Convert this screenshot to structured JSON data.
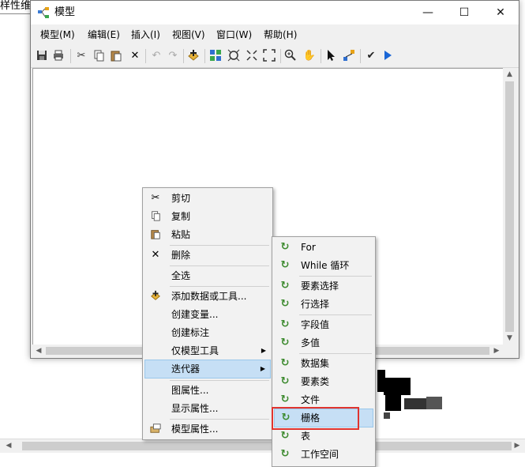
{
  "background": {
    "title_fragment": "样性维"
  },
  "window": {
    "title": "模型",
    "buttons": {
      "minimize": "—",
      "maximize": "☐",
      "close": "✕"
    }
  },
  "menubar": [
    "模型(M)",
    "编辑(E)",
    "插入(I)",
    "视图(V)",
    "窗口(W)",
    "帮助(H)"
  ],
  "toolbar_icons": [
    "save-icon",
    "print-icon",
    "cut-icon",
    "copy-icon",
    "paste-icon",
    "delete-icon",
    "undo-icon",
    "redo-icon",
    "add-data-icon",
    "auto-layout-icon",
    "full-extent-icon",
    "fixed-zoom-in-icon",
    "fixed-zoom-out-icon",
    "zoom-in-icon",
    "pan-icon",
    "select-icon",
    "connect-icon",
    "validate-icon",
    "run-icon"
  ],
  "context_menu": {
    "items": [
      {
        "label": "剪切",
        "icon": "cut-icon"
      },
      {
        "label": "复制",
        "icon": "copy-icon"
      },
      {
        "label": "粘贴",
        "icon": "paste-icon"
      },
      {
        "label": "删除",
        "icon": "delete-icon"
      },
      {
        "label": "全选",
        "icon": ""
      },
      {
        "label": "添加数据或工具...",
        "icon": "add-data-icon"
      },
      {
        "label": "创建变量...",
        "icon": ""
      },
      {
        "label": "创建标注",
        "icon": ""
      },
      {
        "label": "仅模型工具",
        "icon": "",
        "submenu": true
      },
      {
        "label": "迭代器",
        "icon": "",
        "submenu": true,
        "highlighted": true
      },
      {
        "label": "图属性...",
        "icon": ""
      },
      {
        "label": "显示属性...",
        "icon": ""
      },
      {
        "label": "模型属性...",
        "icon": "model-properties-icon"
      }
    ]
  },
  "iterator_menu": {
    "items": [
      {
        "label": "For"
      },
      {
        "label": "While 循环"
      },
      {
        "label": "要素选择"
      },
      {
        "label": "行选择"
      },
      {
        "label": "字段值"
      },
      {
        "label": "多值"
      },
      {
        "label": "数据集"
      },
      {
        "label": "要素类"
      },
      {
        "label": "文件"
      },
      {
        "label": "栅格",
        "highlighted": true
      },
      {
        "label": "表"
      },
      {
        "label": "工作空间"
      }
    ]
  },
  "colors": {
    "highlight": "#c6dff5",
    "annotation_box": "#e0342f",
    "iterator_icon": "#3c8a2e"
  }
}
